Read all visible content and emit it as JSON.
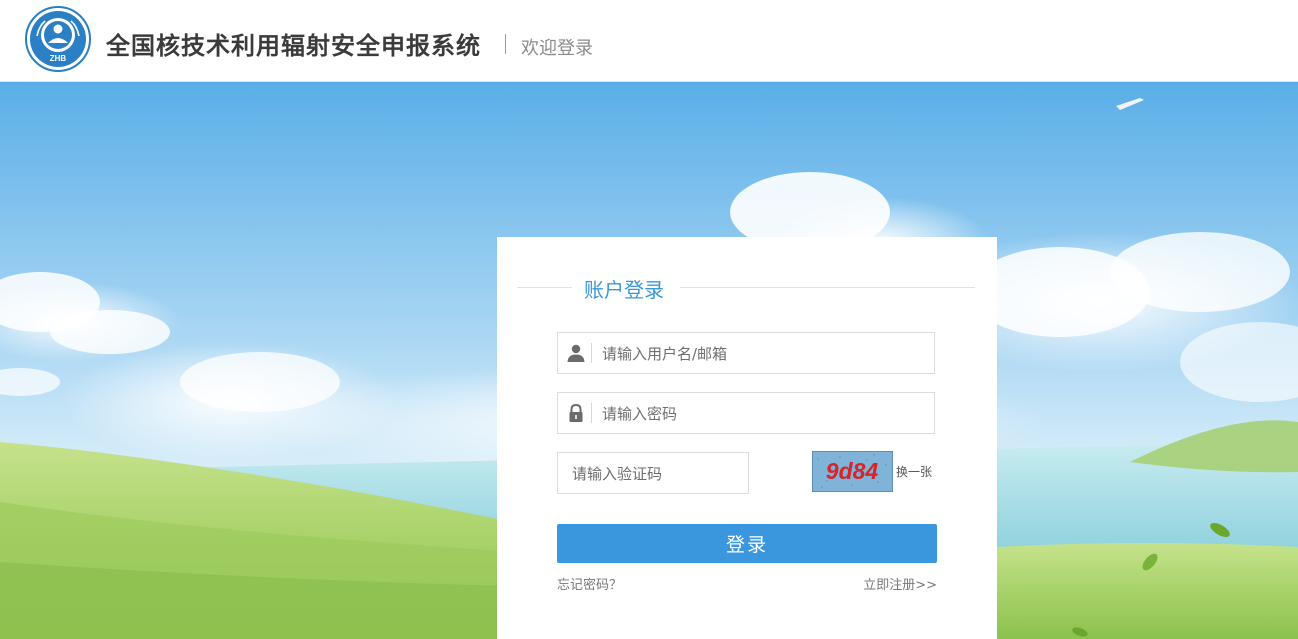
{
  "header": {
    "logo_text": "ZHB",
    "system_title": "全国核技术利用辐射安全申报系统",
    "welcome": "欢迎登录"
  },
  "login": {
    "title": "账户登录",
    "username_placeholder": "请输入用户名/邮箱",
    "password_placeholder": "请输入密码",
    "captcha_placeholder": "请输入验证码",
    "captcha_code": "9d84",
    "refresh_label": "换一张",
    "submit_label": "登录",
    "forgot_label": "忘记密码？",
    "register_label": "立即注册>>"
  },
  "colors": {
    "accent": "#3a97dd",
    "title_blue": "#3a97d6",
    "captcha_text": "#d8232a",
    "captcha_bg": "#7fb3d8"
  },
  "icons": [
    "user-icon",
    "lock-icon"
  ]
}
